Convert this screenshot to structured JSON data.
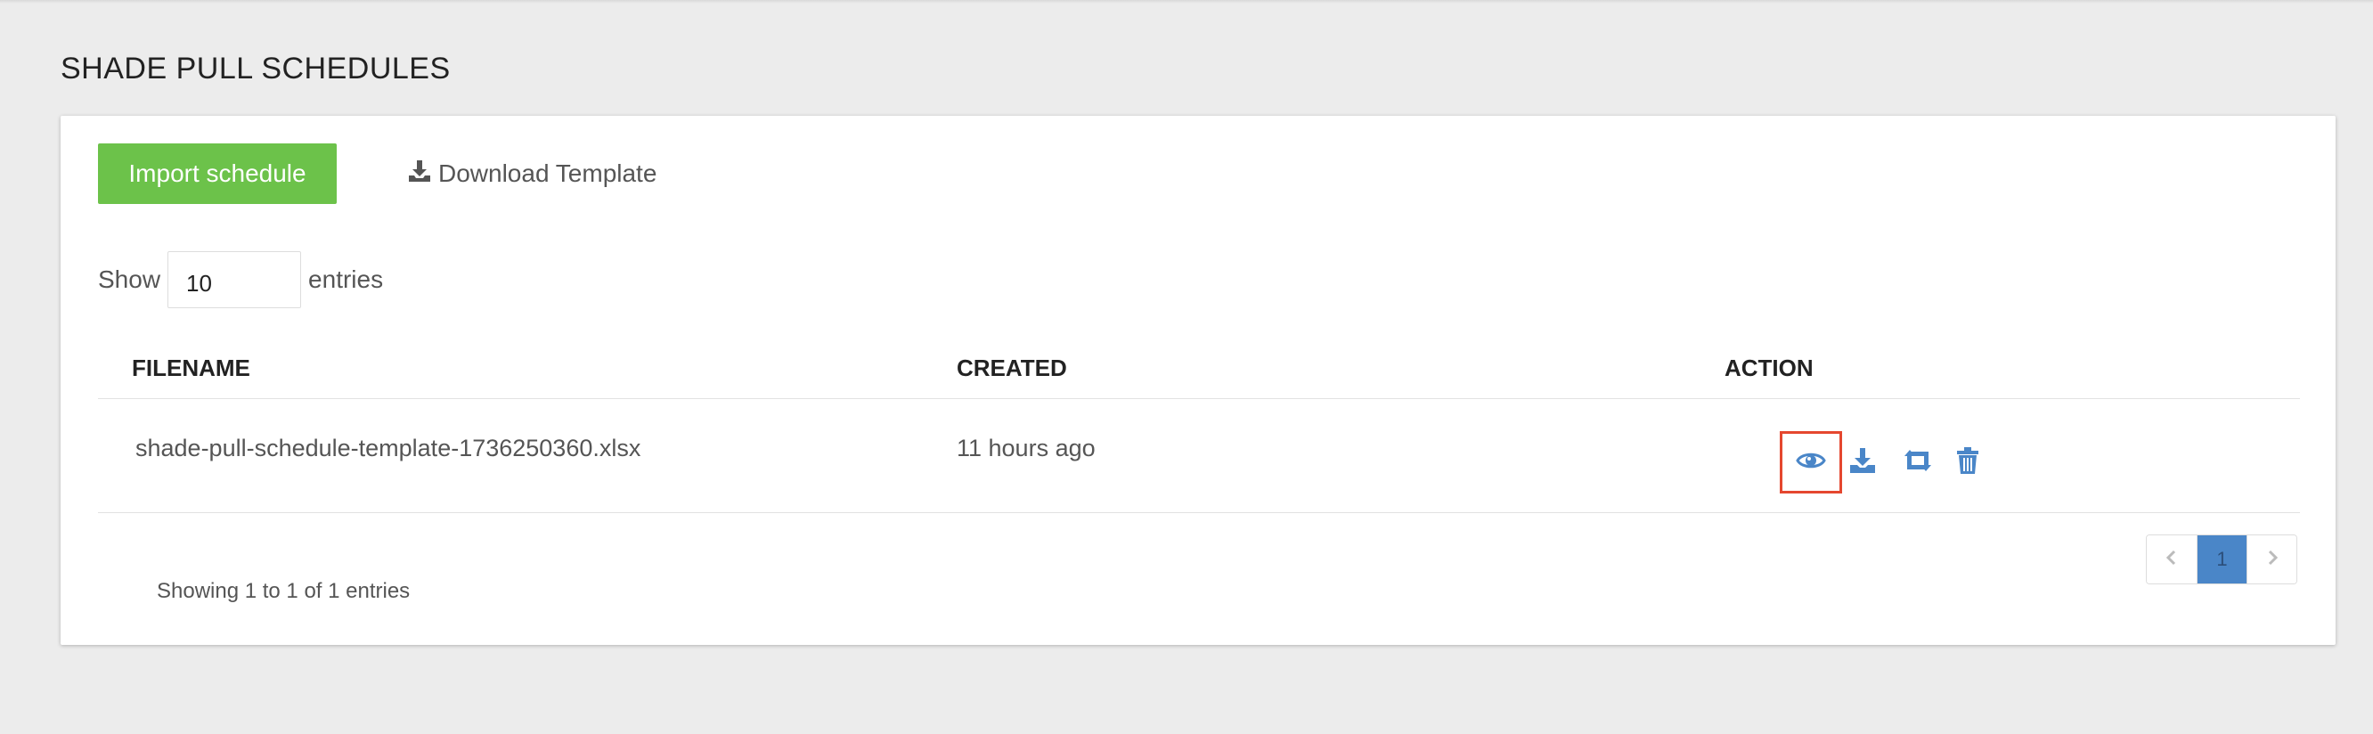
{
  "page": {
    "title": "SHADE PULL SCHEDULES"
  },
  "toolbar": {
    "import_label": "Import schedule",
    "download_template_label": "Download Template"
  },
  "length": {
    "show_label": "Show",
    "value": "10",
    "entries_label": "entries"
  },
  "table": {
    "headers": {
      "filename": "FILENAME",
      "created": "CREATED",
      "action": "ACTION"
    },
    "rows": [
      {
        "filename": "shade-pull-schedule-template-1736250360.xlsx",
        "created": "11 hours ago"
      }
    ]
  },
  "actions": [
    "eye-icon",
    "download-icon",
    "retweet-icon",
    "trash-icon"
  ],
  "info": "Showing 1 to 1 of 1 entries",
  "pagination": {
    "current": "1"
  },
  "colors": {
    "primary_button": "#6cc24a",
    "icon_blue": "#4a86c8",
    "highlight": "#e5472f",
    "background": "#ececec"
  }
}
